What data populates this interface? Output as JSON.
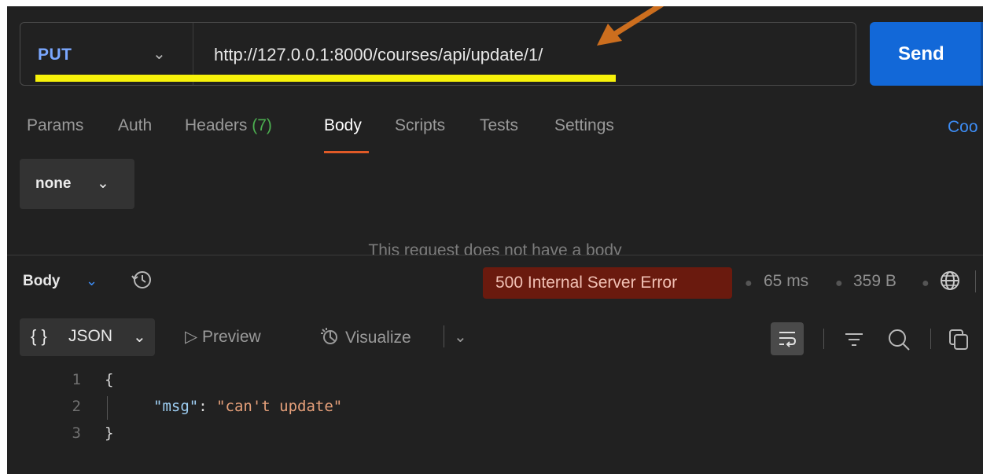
{
  "request": {
    "method": "PUT",
    "method_chevron": "⌄",
    "url": "http://127.0.0.1:8000/courses/api/update/1/",
    "send_label": "Send"
  },
  "tabs": [
    {
      "label": "Params"
    },
    {
      "label": "Auth"
    },
    {
      "label": "Headers",
      "count": "(7)"
    },
    {
      "label": "Body"
    },
    {
      "label": "Scripts"
    },
    {
      "label": "Tests"
    },
    {
      "label": "Settings"
    }
  ],
  "cookies_label": "Coo",
  "body_type": {
    "label": "none",
    "chevron": "⌄"
  },
  "no_body_message": "This request does not have a body",
  "response": {
    "body_label": "Body",
    "body_chevron": "⌄",
    "status": "500 Internal Server Error",
    "time": "65 ms",
    "size": "359 B",
    "format_braces": "{ }",
    "format_label": "JSON",
    "format_chevron": "⌄",
    "preview_label": "▷  Preview",
    "visualize_label": "Visualize",
    "visualize_chevron": "⌄",
    "code_lines": [
      {
        "num": "1",
        "text": "{"
      },
      {
        "num": "2",
        "key": "\"msg\"",
        "sep": ": ",
        "value": "\"can't update\""
      },
      {
        "num": "3",
        "text": "}"
      }
    ]
  },
  "colors": {
    "accent_send": "#1268d8",
    "method_color": "#7aa7ff",
    "status_bg": "#6a1a0e",
    "highlight_underline": "#f7f20a",
    "annotation_arrow": "#cc6e1e",
    "active_tab_underline": "#e05a27"
  },
  "icons": [
    "history-icon",
    "globe-icon",
    "wrap-icon",
    "filter-icon",
    "search-icon",
    "copy-icon",
    "visualize-icon",
    "arrow-annotation"
  ]
}
